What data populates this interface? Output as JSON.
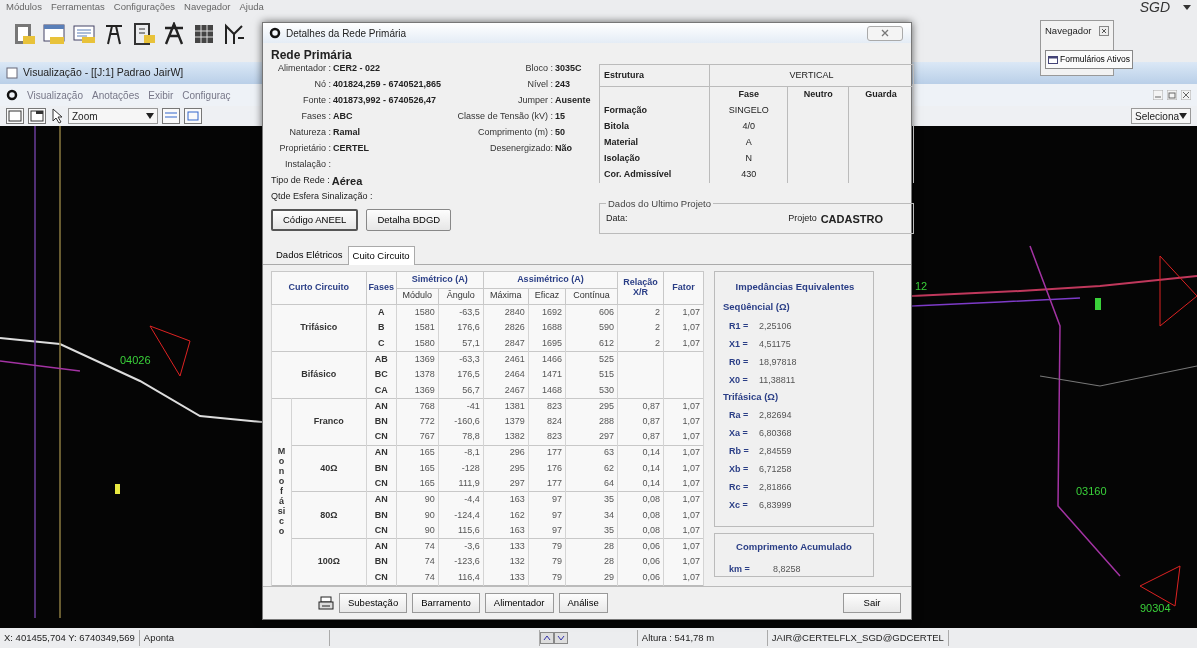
{
  "menu": [
    "Módulos",
    "Ferramentas",
    "Configurações",
    "Navegador",
    "Ajuda"
  ],
  "brand": "SGD",
  "navigator": {
    "title": "Navegador",
    "button": "Formulários Ativos"
  },
  "view": {
    "title": "Visualização - [[J:1] Padrao JairW]",
    "menu": [
      "Visualização",
      "Anotações",
      "Exibir",
      "Configuraç"
    ],
    "zoom": "Zoom",
    "select": "Seleciona"
  },
  "map_labels": [
    "04026",
    "12",
    "03160",
    "90304"
  ],
  "dialog": {
    "title": "Detalhes da Rede Primária",
    "heading": "Rede Primária",
    "info_rows": [
      {
        "kind": "pair",
        "label": "Alimentador :",
        "value": "CER2 - 022",
        "label2": "Bloco :",
        "value2": "3035C"
      },
      {
        "kind": "pair",
        "label": "Nó :",
        "value": "401824,259 - 6740521,865",
        "label2": "Nível :",
        "value2": "243"
      },
      {
        "kind": "pair",
        "label": "Fonte :",
        "value": "401873,992 - 6740526,47",
        "label2": "Jumper :",
        "value2": "Ausente"
      },
      {
        "kind": "pair",
        "label": "Fases :",
        "value": "ABC",
        "label2": "Classe de Tensão (kV) :",
        "value2": "15"
      },
      {
        "kind": "pair",
        "label": "Natureza :",
        "value": "Ramal",
        "label2": "Comprimento (m) :",
        "value2": "50"
      },
      {
        "kind": "pair",
        "label": "Proprietário :",
        "value": "CERTEL",
        "label2": "Desenergizado:",
        "value2": "Não"
      },
      {
        "kind": "pair",
        "label": "Instalação :"
      },
      {
        "kind": "wide",
        "label": "Tipo de Rede :",
        "value": "Aérea"
      },
      {
        "kind": "wide",
        "label": "Qtde Esfera Sinalização :"
      }
    ],
    "buttons": [
      "Código ANEEL",
      "Detalha BDGD"
    ],
    "structure": {
      "label": "Estrutura",
      "value": "VERTICAL",
      "columns": [
        "Fase",
        "Neutro",
        "Guarda"
      ],
      "rows": [
        {
          "label": "Formação",
          "value": "SINGELO"
        },
        {
          "label": "Bitola",
          "value": "4/0"
        },
        {
          "label": "Material",
          "value": "A"
        },
        {
          "label": "Isolação",
          "value": "N"
        },
        {
          "label": "Cor. Admissível",
          "value": "430"
        }
      ]
    },
    "project": {
      "legend": "Dados do Ultimo Projeto",
      "date_label": "Data:",
      "project_label": "Projeto",
      "project": "CADASTRO"
    },
    "tabs": [
      {
        "label": "Dados Elétricos",
        "selected": false
      },
      {
        "label": "Cuito Circuito",
        "selected": true
      }
    ],
    "short_circuit": {
      "header": {
        "type": "Curto Circuito",
        "phases": "Fases",
        "sym": "Simétrico (A)",
        "sym_cols": [
          "Módulo",
          "Ângulo"
        ],
        "asym": "Assimétrico (A)",
        "asym_cols": [
          "Máxima",
          "Eficaz",
          "Contínua"
        ],
        "ratio": "Relação X/R",
        "factor": "Fator"
      },
      "groups": [
        {
          "label": "Trifásico",
          "rows": [
            {
              "phase": "A",
              "cells": [
                "1580",
                "-63,5",
                "2840",
                "1692",
                "606",
                "2",
                "1,07"
              ]
            },
            {
              "phase": "B",
              "cells": [
                "1581",
                "176,6",
                "2826",
                "1688",
                "590",
                "2",
                "1,07"
              ]
            },
            {
              "phase": "C",
              "cells": [
                "1580",
                "57,1",
                "2847",
                "1695",
                "612",
                "2",
                "1,07"
              ]
            }
          ]
        },
        {
          "label": "Bifásico",
          "rows": [
            {
              "phase": "AB",
              "cells": [
                "1369",
                "-63,3",
                "2461",
                "1466",
                "525"
              ]
            },
            {
              "phase": "BC",
              "cells": [
                "1378",
                "176,5",
                "2464",
                "1471",
                "515"
              ]
            },
            {
              "phase": "CA",
              "cells": [
                "1369",
                "56,7",
                "2467",
                "1468",
                "530"
              ]
            }
          ]
        }
      ],
      "mono": {
        "label": "Monofásico",
        "groups": [
          {
            "label": "Franco",
            "rows": [
              {
                "phase": "AN",
                "cells": [
                  "768",
                  "-41",
                  "1381",
                  "823",
                  "295",
                  "0,87",
                  "1,07"
                ]
              },
              {
                "phase": "BN",
                "cells": [
                  "772",
                  "-160,6",
                  "1379",
                  "824",
                  "288",
                  "0,87",
                  "1,07"
                ]
              },
              {
                "phase": "CN",
                "cells": [
                  "767",
                  "78,8",
                  "1382",
                  "823",
                  "297",
                  "0,87",
                  "1,07"
                ]
              }
            ]
          },
          {
            "label": "40Ω",
            "rows": [
              {
                "phase": "AN",
                "cells": [
                  "165",
                  "-8,1",
                  "296",
                  "177",
                  "63",
                  "0,14",
                  "1,07"
                ]
              },
              {
                "phase": "BN",
                "cells": [
                  "165",
                  "-128",
                  "295",
                  "176",
                  "62",
                  "0,14",
                  "1,07"
                ]
              },
              {
                "phase": "CN",
                "cells": [
                  "165",
                  "111,9",
                  "297",
                  "177",
                  "64",
                  "0,14",
                  "1,07"
                ]
              }
            ]
          },
          {
            "label": "80Ω",
            "rows": [
              {
                "phase": "AN",
                "cells": [
                  "90",
                  "-4,4",
                  "163",
                  "97",
                  "35",
                  "0,08",
                  "1,07"
                ]
              },
              {
                "phase": "BN",
                "cells": [
                  "90",
                  "-124,4",
                  "162",
                  "97",
                  "34",
                  "0,08",
                  "1,07"
                ]
              },
              {
                "phase": "CN",
                "cells": [
                  "90",
                  "115,6",
                  "163",
                  "97",
                  "35",
                  "0,08",
                  "1,07"
                ]
              }
            ]
          },
          {
            "label": "100Ω",
            "rows": [
              {
                "phase": "AN",
                "cells": [
                  "74",
                  "-3,6",
                  "133",
                  "79",
                  "28",
                  "0,06",
                  "1,07"
                ]
              },
              {
                "phase": "BN",
                "cells": [
                  "74",
                  "-123,6",
                  "132",
                  "79",
                  "28",
                  "0,06",
                  "1,07"
                ]
              },
              {
                "phase": "CN",
                "cells": [
                  "74",
                  "116,4",
                  "133",
                  "79",
                  "29",
                  "0,06",
                  "1,07"
                ]
              }
            ]
          }
        ]
      }
    },
    "impedances": {
      "title": "Impedâncias Equivalentes",
      "sections": [
        {
          "title": "Seqüêncial (Ω)",
          "items": [
            {
              "label": "R1 =",
              "value": "2,25106"
            },
            {
              "label": "X1 =",
              "value": "4,51175"
            },
            {
              "label": "R0 =",
              "value": "18,97818"
            },
            {
              "label": "X0 =",
              "value": "11,38811"
            }
          ]
        },
        {
          "title": "Trifásica (Ω)",
          "items": [
            {
              "label": "Ra =",
              "value": "2,82694"
            },
            {
              "label": "Xa =",
              "value": "6,80368"
            },
            {
              "label": "Rb =",
              "value": "2,84559"
            },
            {
              "label": "Xb =",
              "value": "6,71258"
            },
            {
              "label": "Rc =",
              "value": "2,81866"
            },
            {
              "label": "Xc =",
              "value": "6,83999"
            }
          ]
        }
      ]
    },
    "accumulated": {
      "title": "Comprimento Acumulado",
      "label": "km =",
      "value": "8,8258"
    },
    "footer_buttons": [
      "Subestação",
      "Barramento",
      "Alimentador",
      "Análise"
    ],
    "exit": "Sair"
  },
  "status_bar": {
    "coords": "X: 401455,704  Y: 6740349,569",
    "mode": "Aponta",
    "altitude": "Altura : 541,78 m",
    "user": "JAIR@CERTELFLX_SGD@GDCERTEL"
  }
}
